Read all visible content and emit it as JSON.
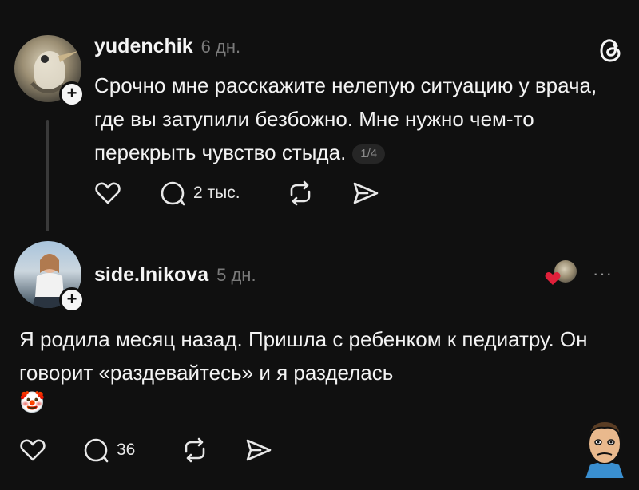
{
  "post": {
    "username": "yudenchik",
    "time": "6 дн.",
    "text": "Срочно мне расскажите нелепую ситуацию у врача, где вы затупили безбожно. Мне нужно чем-то перекрыть чувство стыда.",
    "page_indicator": "1/4",
    "actions": {
      "replies": "2 тыс."
    },
    "icons": [
      "threads-logo-icon",
      "heart-icon",
      "comment-icon",
      "repost-icon",
      "share-icon"
    ]
  },
  "reply": {
    "username": "side.lnikova",
    "time": "5 дн.",
    "text": "Я родила месяц назад. Пришла с ребенком к педиатру. Он говорит «раздевайтесь» и я разделась",
    "emoji": "🤡",
    "actions": {
      "replies": "36"
    },
    "more_label": "···"
  },
  "colors": {
    "background": "#101010",
    "text": "#f3f3f3",
    "muted": "#7a7a7a",
    "accent_heart": "#e0203a"
  }
}
